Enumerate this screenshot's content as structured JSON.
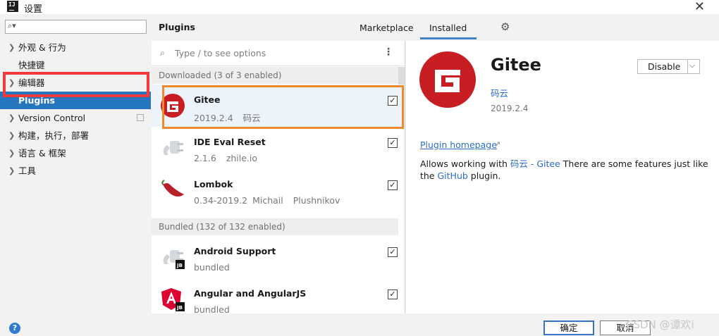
{
  "window": {
    "title": "设置",
    "app_icon_text": "IJ"
  },
  "sidebar": {
    "search_placeholder": "",
    "items": [
      {
        "label": "外观 & 行为",
        "expandable": true
      },
      {
        "label": "快捷键",
        "expandable": false
      },
      {
        "label": "编辑器",
        "expandable": true
      },
      {
        "label": "Plugins",
        "expandable": false,
        "selected": true
      },
      {
        "label": "Version Control",
        "expandable": true
      },
      {
        "label": "构建，执行，部署",
        "expandable": true
      },
      {
        "label": "语言 & 框架",
        "expandable": true
      },
      {
        "label": "工具",
        "expandable": true
      }
    ]
  },
  "header": {
    "title": "Plugins",
    "tabs": [
      {
        "label": "Marketplace",
        "active": false
      },
      {
        "label": "Installed",
        "active": true
      }
    ]
  },
  "list": {
    "search_placeholder": "Type / to see options",
    "downloaded_header": "Downloaded (3 of 3 enabled)",
    "bundled_header": "Bundled (132 of 132 enabled)",
    "downloaded": [
      {
        "name": "Gitee",
        "version": "2019.2.4",
        "vendor": "码云",
        "checked": true,
        "icon": "gitee-icon"
      },
      {
        "name": "IDE Eval Reset",
        "version": "2.1.6",
        "vendor": "zhile.io",
        "checked": true,
        "icon": "plug-icon"
      },
      {
        "name": "Lombok",
        "version": "0.34-2019.2",
        "vendor": "Michail",
        "vendor2": "Plushnikov",
        "checked": true,
        "icon": "chili-icon"
      }
    ],
    "bundled": [
      {
        "name": "Android Support",
        "version": "bundled",
        "checked": true,
        "icon": "plug-jb-icon"
      },
      {
        "name": "Angular and AngularJS",
        "version": "bundled",
        "checked": true,
        "icon": "angular-icon"
      }
    ]
  },
  "detail": {
    "name": "Gitee",
    "vendor": "码云",
    "version": "2019.2.4",
    "disable_label": "Disable",
    "homepage_label": "Plugin homepage",
    "desc_part1": "Allows working with ",
    "desc_link1": "码云 - Gitee",
    "desc_part2": " There are some features just like the ",
    "desc_link2": "GitHub",
    "desc_part3": " plugin."
  },
  "buttons": {
    "ok": "确定",
    "cancel": "取消"
  },
  "watermark": "CSDN @谭欢i",
  "colors": {
    "selection": "#2675bf",
    "highlight_red": "#ef3b3b",
    "highlight_orange": "#f08a2c",
    "gitee_red": "#c71d23",
    "link": "#2b6ec4"
  }
}
